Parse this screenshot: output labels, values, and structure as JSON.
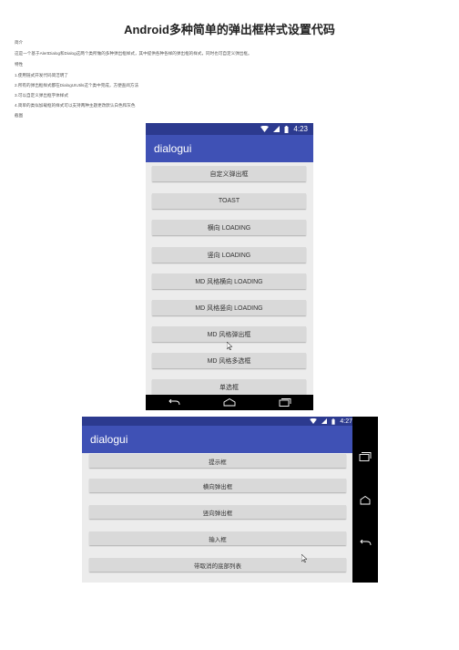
{
  "doc": {
    "title": "Android多种简单的弹出框样式设置代码",
    "paragraphs": [
      "简介",
      "这是一个基于AlertDialog和Dialog这两个类所做的多种弹出框样式，其中提供各种各样的弹出框的样式，同时也可自定义弹出框。",
      "特性",
      "1.使用链式开发代码简洁明了",
      "2.所有的弹出框样式都在DialogUIUtils这个类中完成，方便查阅方法",
      "3.可以自定义弹出框字体样式",
      "4.简单的类似加载框的样式可以支持两种主题更改默认白色和灰色",
      "截图"
    ]
  },
  "phone1": {
    "time": "4:23",
    "app_title": "dialogui",
    "buttons": [
      "自定义弹出框",
      "TOAST",
      "横向 LOADING",
      "竖向 LOADING",
      "MD 风格横向 LOADING",
      "MD 风格竖向 LOADING",
      "MD 风格弹出框",
      "MD 风格多选框",
      "单选框"
    ]
  },
  "phone2": {
    "time": "4:27",
    "app_title": "dialogui",
    "buttons": [
      "提示框",
      "横向弹出框",
      "竖向弹出框",
      "输入框",
      "带取消的底部列表"
    ]
  }
}
